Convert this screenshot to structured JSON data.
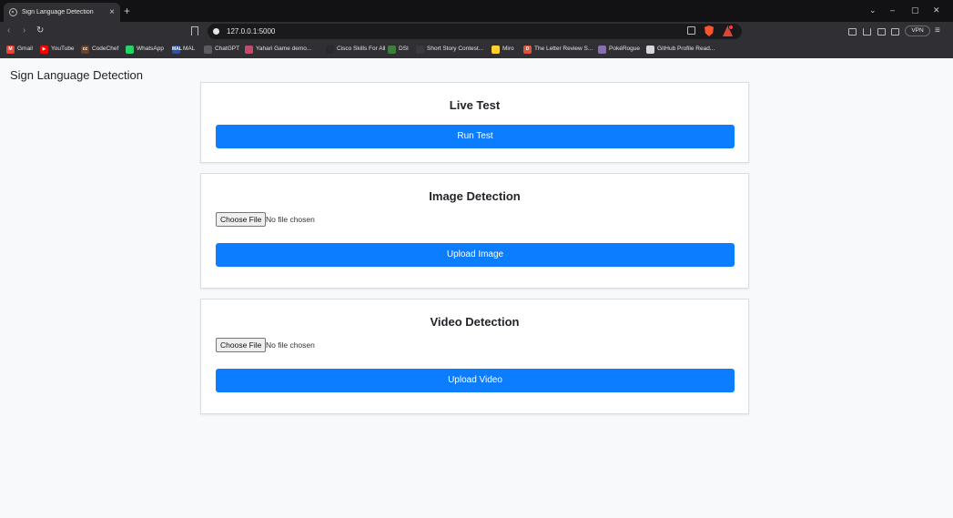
{
  "browser": {
    "tab_title": "Sign Language Detection",
    "tab_close": "×",
    "new_tab": "+",
    "url": "127.0.0.1:5000",
    "vpn_label": "VPN",
    "window_controls": [
      "⌄",
      "–",
      "▢",
      "✕"
    ],
    "nav": {
      "back": "‹",
      "forward": "›",
      "reload": "↻"
    },
    "menu": "≡",
    "bookmarks": [
      {
        "label": "Gmail",
        "icon": "gmail-icon",
        "color": "#ea4335",
        "glyph": "M"
      },
      {
        "label": "YouTube",
        "icon": "youtube-icon",
        "color": "#ff0000",
        "glyph": "▶"
      },
      {
        "label": "CodeChef",
        "icon": "codechef-icon",
        "color": "#6b4226",
        "glyph": "cc"
      },
      {
        "label": "WhatsApp",
        "icon": "whatsapp-icon",
        "color": "#25d366",
        "glyph": ""
      },
      {
        "label": "MAL",
        "icon": "mal-icon",
        "color": "#2e51a2",
        "glyph": "MAL"
      },
      {
        "label": "ChatGPT",
        "icon": "chatgpt-icon",
        "color": "#5c5c60",
        "glyph": ""
      },
      {
        "label": "Yahari Game demo...",
        "icon": "yahari-icon",
        "color": "#c24a6a",
        "glyph": ""
      },
      {
        "label": "Cisco Skills For All",
        "icon": "cisco-icon",
        "color": "#2a2a2e",
        "glyph": ""
      },
      {
        "label": "DSI",
        "icon": "dsi-icon",
        "color": "#3f7d3f",
        "glyph": ""
      },
      {
        "label": "Short Story Contest...",
        "icon": "reedsy-icon",
        "color": "#3a3a3e",
        "glyph": ""
      },
      {
        "label": "Miro",
        "icon": "miro-icon",
        "color": "#ffd02f",
        "glyph": ""
      },
      {
        "label": "The Letter Review S...",
        "icon": "letter-review-icon",
        "color": "#e0523a",
        "glyph": "D"
      },
      {
        "label": "PokéRogue",
        "icon": "pokerogue-icon",
        "color": "#8a6fb0",
        "glyph": ""
      },
      {
        "label": "GitHub Profile Read...",
        "icon": "github-readme-icon",
        "color": "#d8d8dc",
        "glyph": ""
      }
    ]
  },
  "page": {
    "brand": "Sign Language Detection",
    "live_test": {
      "title": "Live Test",
      "button": "Run Test"
    },
    "image_detection": {
      "title": "Image Detection",
      "choose_file": "Choose File",
      "file_status": "No file chosen",
      "button": "Upload Image"
    },
    "video_detection": {
      "title": "Video Detection",
      "choose_file": "Choose File",
      "file_status": "No file chosen",
      "button": "Upload Video"
    }
  },
  "colors": {
    "primary": "#0d7dff",
    "page_bg": "#f8f9fa",
    "chrome_bg": "#303034"
  }
}
